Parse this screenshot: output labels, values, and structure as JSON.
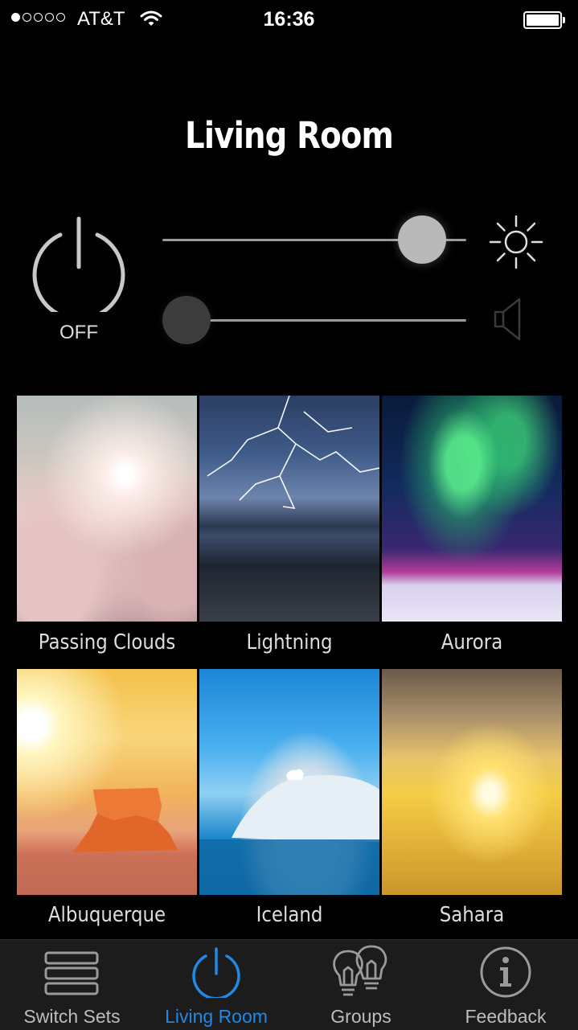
{
  "status_bar": {
    "carrier": "AT&T",
    "time": "16:36",
    "signal_dots_filled": 1,
    "signal_dots_total": 5,
    "battery_level": 1.0
  },
  "header": {
    "title": "Living Room"
  },
  "controls": {
    "power_state": "OFF",
    "brightness_level": 0.92,
    "volume_level": 0.0,
    "brightness_icon": "sun-icon",
    "volume_icon": "speaker-icon"
  },
  "scenes": [
    {
      "label": "Passing Clouds"
    },
    {
      "label": "Lightning"
    },
    {
      "label": "Aurora"
    },
    {
      "label": "Albuquerque"
    },
    {
      "label": "Iceland"
    },
    {
      "label": "Sahara"
    }
  ],
  "tabs": [
    {
      "label": "Switch Sets",
      "icon": "list-icon"
    },
    {
      "label": "Living Room",
      "icon": "power-icon"
    },
    {
      "label": "Groups",
      "icon": "bulbs-icon"
    },
    {
      "label": "Feedback",
      "icon": "info-icon"
    }
  ],
  "colors": {
    "accent": "#1e8ae6",
    "background": "#000000",
    "tabbar": "#1c1c1c"
  }
}
